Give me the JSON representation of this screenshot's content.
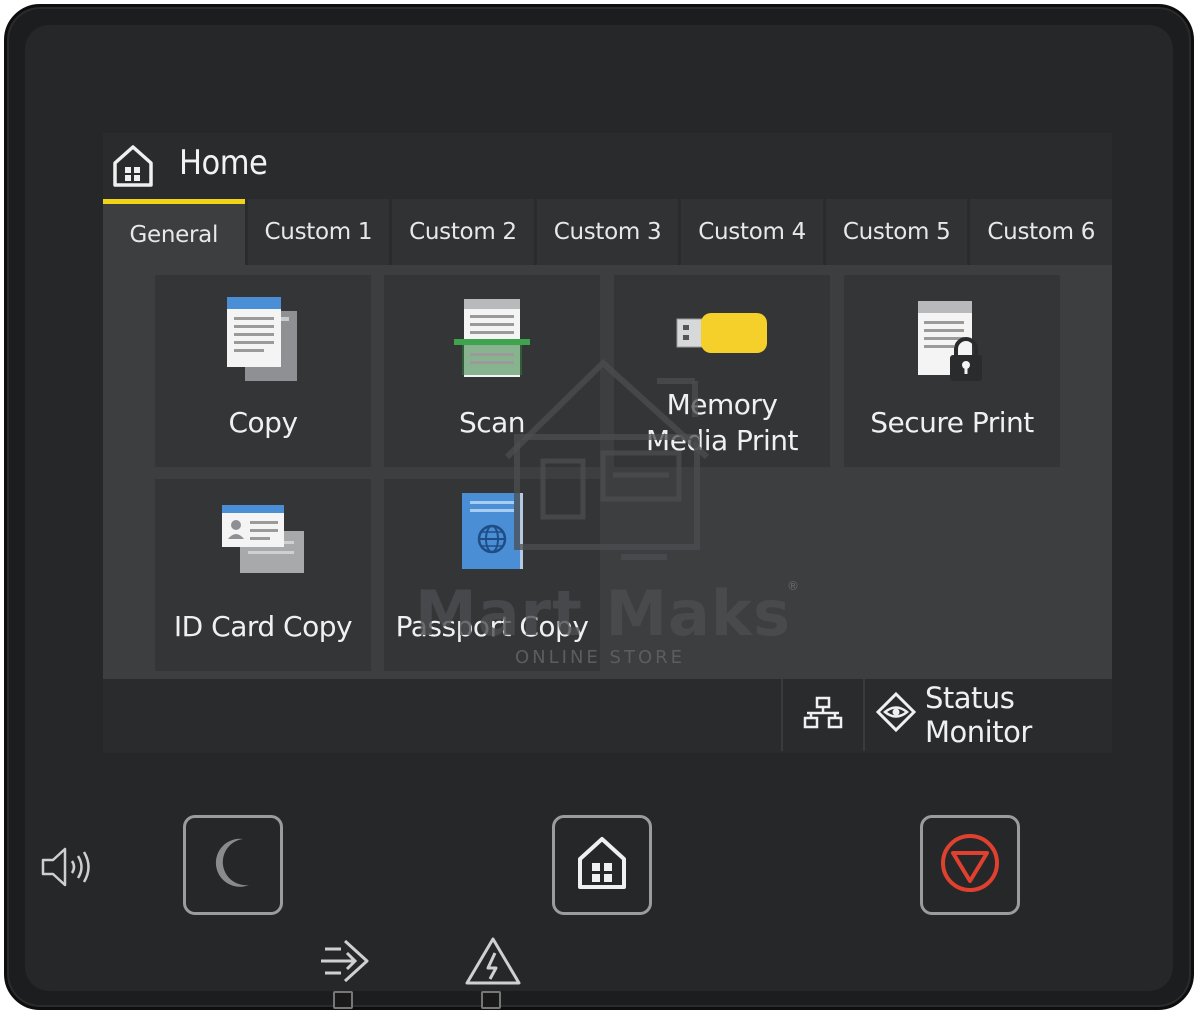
{
  "header": {
    "title": "Home"
  },
  "tabs": [
    {
      "label": "General",
      "active": true
    },
    {
      "label": "Custom 1",
      "active": false
    },
    {
      "label": "Custom 2",
      "active": false
    },
    {
      "label": "Custom 3",
      "active": false
    },
    {
      "label": "Custom 4",
      "active": false
    },
    {
      "label": "Custom 5",
      "active": false
    },
    {
      "label": "Custom 6",
      "active": false
    }
  ],
  "tiles": [
    {
      "label": "Copy",
      "icon": "copy-icon"
    },
    {
      "label": "Scan",
      "icon": "scan-icon"
    },
    {
      "label_line1": "Memory",
      "label_line2": "Media Print",
      "icon": "usb-memory-icon"
    },
    {
      "label": "Secure Print",
      "icon": "secure-print-icon"
    },
    {
      "label": "ID Card Copy",
      "icon": "id-card-icon"
    },
    {
      "label": "Passport Copy",
      "icon": "passport-icon"
    }
  ],
  "bottom_bar": {
    "network_icon": "network-icon",
    "status_monitor_label": "Status Monitor",
    "status_icon": "eye-diamond-icon"
  },
  "hardware": {
    "volume_icon": "speaker-icon",
    "sleep_icon": "moon-icon",
    "home_icon": "home-icon",
    "stop_icon": "stop-icon",
    "data_icon": "data-in-icon",
    "error_icon": "warning-icon"
  },
  "watermark": {
    "brand": "Mart Maks",
    "registered": "®",
    "tagline": "ONLINE STORE"
  },
  "colors": {
    "accent_tab": "#f3d315",
    "stop": "#e0412f",
    "usb_yellow": "#f5cf2a",
    "scan_green": "#3fa34d",
    "doc_blue": "#4a8fd6"
  }
}
